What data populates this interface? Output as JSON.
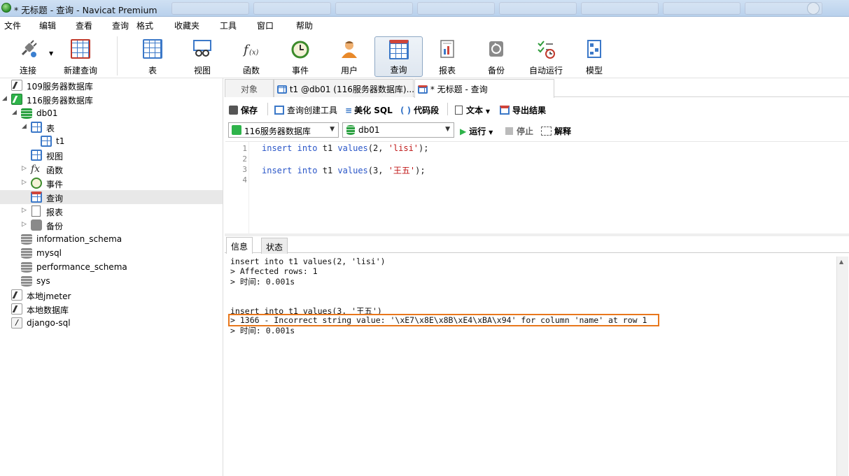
{
  "window": {
    "title": "* 无标题 - 查询 - Navicat Premium"
  },
  "menu": [
    "文件",
    "编辑",
    "查看",
    "查询",
    "格式",
    "收藏夹",
    "工具",
    "窗口",
    "帮助"
  ],
  "toolbar": {
    "connect": "连接",
    "new_query": "新建查询",
    "table": "表",
    "view": "视图",
    "function": "函数",
    "event": "事件",
    "user": "用户",
    "query": "查询",
    "report": "报表",
    "backup": "备份",
    "automation": "自动运行",
    "model": "模型"
  },
  "sidebar": {
    "items": [
      {
        "label": "109服务器数据库"
      },
      {
        "label": "116服务器数据库"
      },
      {
        "label": "db01"
      },
      {
        "label": "表"
      },
      {
        "label": "t1"
      },
      {
        "label": "视图"
      },
      {
        "label": "函数"
      },
      {
        "label": "事件"
      },
      {
        "label": "查询"
      },
      {
        "label": "报表"
      },
      {
        "label": "备份"
      },
      {
        "label": "information_schema"
      },
      {
        "label": "mysql"
      },
      {
        "label": "performance_schema"
      },
      {
        "label": "sys"
      },
      {
        "label": "本地jmeter"
      },
      {
        "label": "本地数据库"
      },
      {
        "label": "django-sql"
      }
    ]
  },
  "tabs": {
    "objects": "对象",
    "t1": "t1 @db01 (116服务器数据库)...",
    "query": "* 无标题 - 查询"
  },
  "query_toolbar": {
    "save": "保存",
    "query_builder": "查询创建工具",
    "beautify": "美化 SQL",
    "snippet": "代码段",
    "text": "文本",
    "export": "导出结果",
    "connection": "116服务器数据库",
    "database": "db01",
    "run": "运行",
    "stop": "停止",
    "explain": "解释"
  },
  "editor": {
    "line_numbers": [
      "1",
      "2",
      "3",
      "4"
    ],
    "line1": {
      "kw1": "insert",
      "kw2": "into",
      "t": "t1",
      "kw3": "values",
      "a": "(2, ",
      "s": "'lisi'",
      "b": ");"
    },
    "line3": {
      "kw1": "insert",
      "kw2": "into",
      "t": "t1",
      "kw3": "values",
      "a": "(3, ",
      "s": "'王五'",
      "b": ");"
    }
  },
  "bottom_tabs": {
    "info": "信息",
    "status": "状态"
  },
  "output": {
    "lines": [
      "insert into t1 values(2, 'lisi')",
      "> Affected rows: 1",
      "> 时间: 0.001s",
      "insert into t1 values(3, '王五')",
      "> 1366 - Incorrect string value: '\\xE7\\x8E\\x8B\\xE4\\xBA\\x94' for column 'name' at row 1",
      "> 时间: 0.001s"
    ]
  },
  "colors": {
    "highlight_border": "#e8771c",
    "keyword": "#2a56c8",
    "string": "#c01818",
    "active_db": "#2eb34a"
  }
}
